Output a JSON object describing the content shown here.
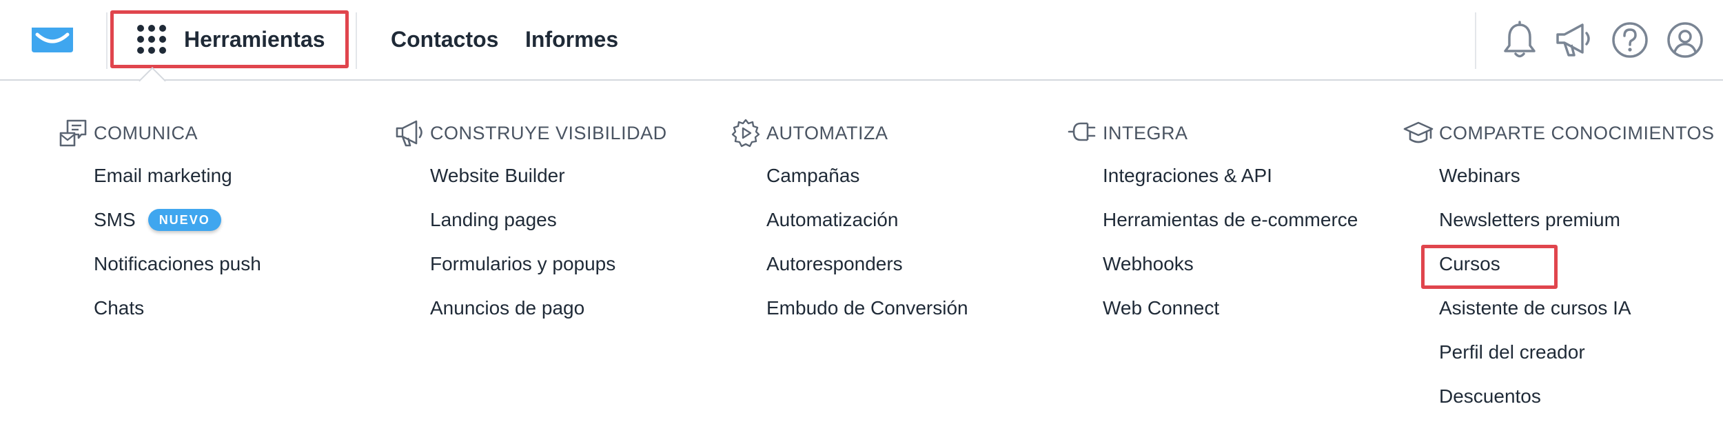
{
  "header": {
    "tools_label": "Herramientas",
    "nav": [
      "Contactos",
      "Informes"
    ]
  },
  "icons": {
    "logo": "envelope-logo-icon",
    "tools": "grid-dots-icon",
    "bell": "bell-icon",
    "megaphone": "megaphone-icon",
    "help": "help-circle-icon",
    "user": "user-circle-icon"
  },
  "colors": {
    "brand": "#3fa6ef",
    "highlight": "#e0454d",
    "text": "#1f2a37",
    "muted": "#4a5462"
  },
  "menu": {
    "columns": [
      {
        "title": "COMUNICA",
        "icon": "chat-envelope-icon",
        "items": [
          "Email marketing",
          "SMS",
          "Notificaciones push",
          "Chats"
        ],
        "badge": "NUEVO"
      },
      {
        "title": "CONSTRUYE VISIBILIDAD",
        "icon": "megaphone-icon",
        "items": [
          "Website Builder",
          "Landing pages",
          "Formularios y popups",
          "Anuncios de pago"
        ]
      },
      {
        "title": "AUTOMATIZA",
        "icon": "gear-play-icon",
        "items": [
          "Campañas",
          "Automatización",
          "Autoresponders",
          "Embudo de Conversión"
        ]
      },
      {
        "title": "INTEGRA",
        "icon": "plug-icon",
        "items": [
          "Integraciones & API",
          "Herramientas de e-commerce",
          "Webhooks",
          "Web Connect"
        ]
      },
      {
        "title": "COMPARTE CONOCIMIENTOS",
        "icon": "graduation-cap-icon",
        "items": [
          "Webinars",
          "Newsletters premium",
          "Cursos",
          "Asistente de cursos IA",
          "Perfil del creador",
          "Descuentos"
        ]
      }
    ]
  }
}
